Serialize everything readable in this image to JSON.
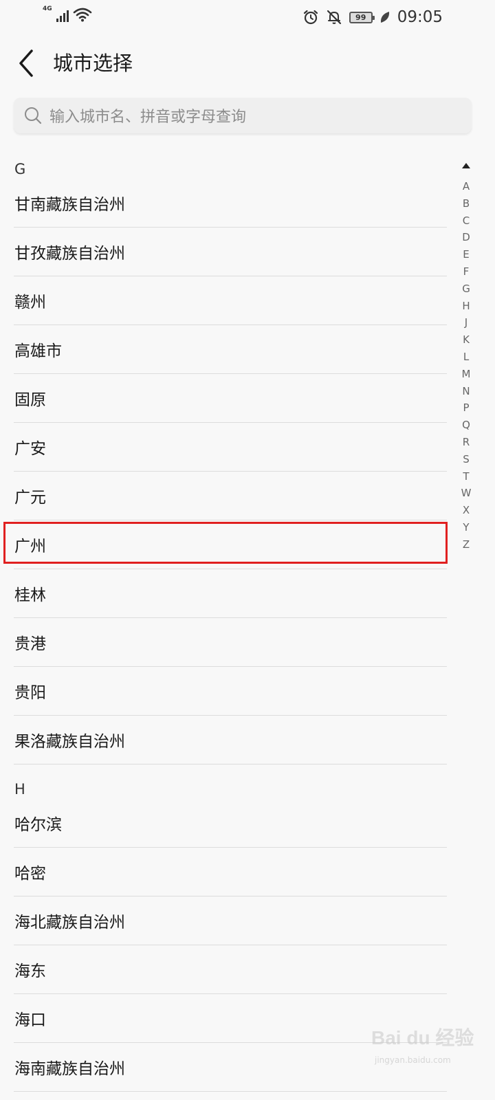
{
  "status_bar": {
    "network": "4G",
    "battery": "99",
    "time": "09:05"
  },
  "header": {
    "title": "城市选择"
  },
  "search": {
    "placeholder": "输入城市名、拼音或字母查询"
  },
  "sections": [
    {
      "letter": "G",
      "cities": [
        "甘南藏族自治州",
        "甘孜藏族自治州",
        "赣州",
        "高雄市",
        "固原",
        "广安",
        "广元",
        "广州",
        "桂林",
        "贵港",
        "贵阳",
        "果洛藏族自治州"
      ]
    },
    {
      "letter": "H",
      "cities": [
        "哈尔滨",
        "哈密",
        "海北藏族自治州",
        "海东",
        "海口",
        "海南藏族自治州"
      ]
    }
  ],
  "highlighted_city": "广州",
  "index_letters": [
    "A",
    "B",
    "C",
    "D",
    "E",
    "F",
    "G",
    "H",
    "J",
    "K",
    "L",
    "M",
    "N",
    "P",
    "Q",
    "R",
    "S",
    "T",
    "W",
    "X",
    "Y",
    "Z"
  ],
  "watermark": {
    "logo": "Bai du 经验",
    "sub": "jingyan.baidu.com"
  }
}
